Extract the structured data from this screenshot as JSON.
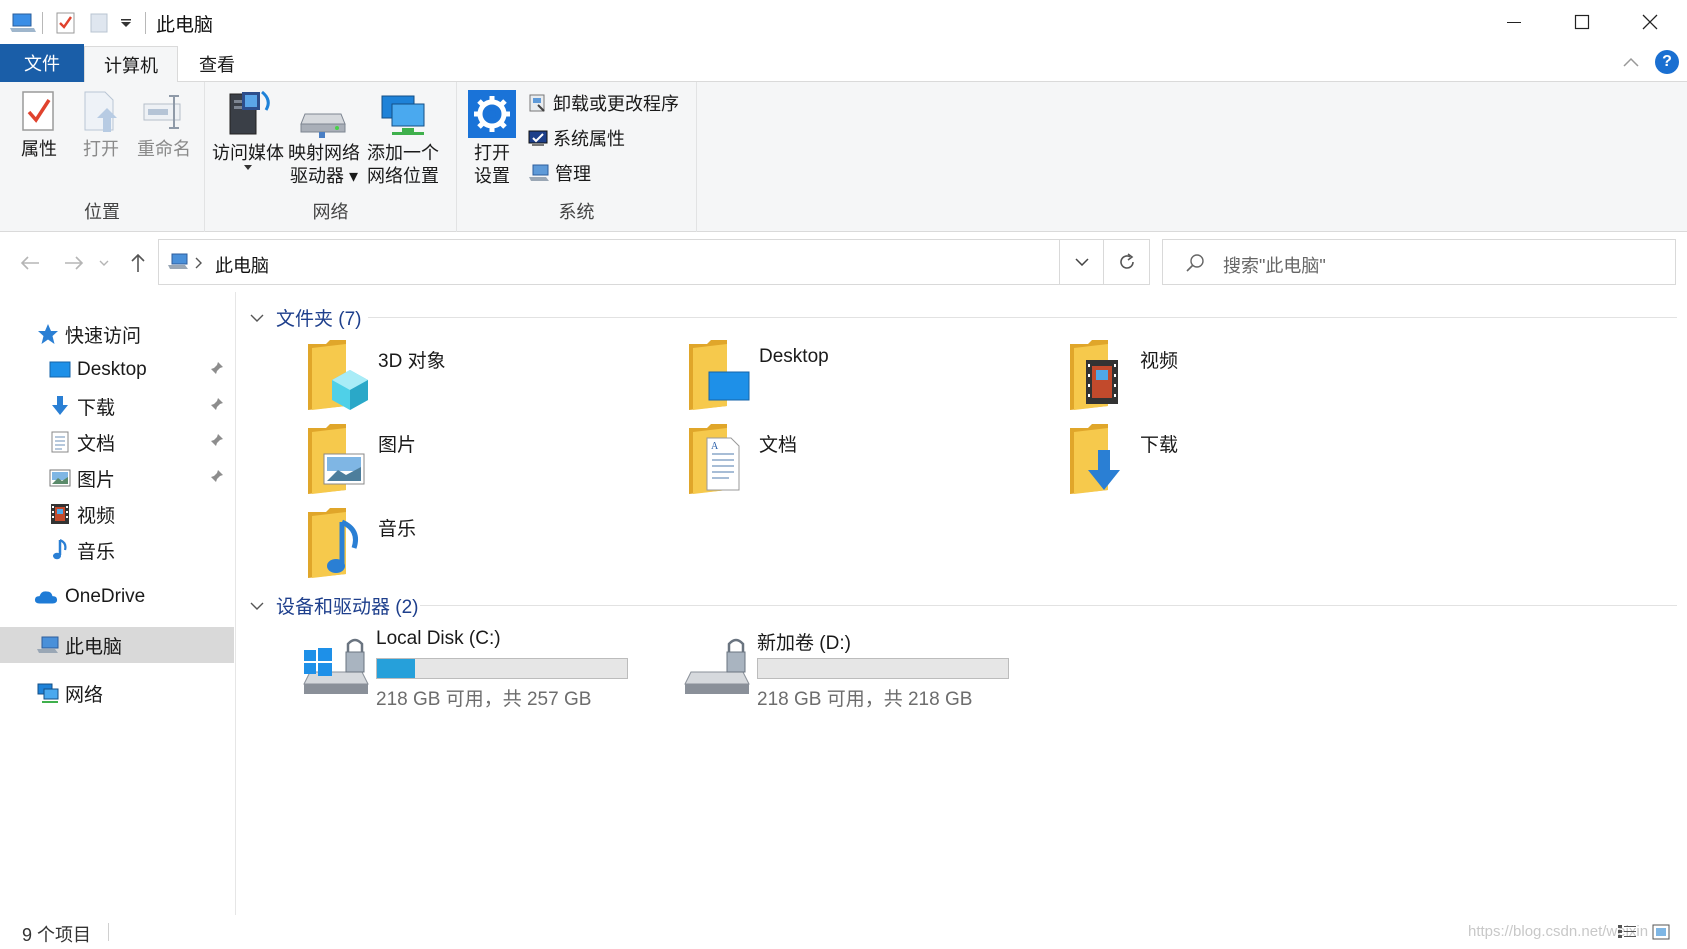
{
  "window": {
    "title": "此电脑"
  },
  "ribbon_tabs": {
    "file": "文件",
    "computer": "计算机",
    "view": "查看",
    "help": "?"
  },
  "ribbon": {
    "location_group": {
      "label": "位置",
      "properties": "属性",
      "open": "打开",
      "rename": "重命名"
    },
    "network_group": {
      "label": "网络",
      "access_media": "访问媒体",
      "map_drive_line1": "映射网络",
      "map_drive_line2": "驱动器",
      "add_location_line1": "添加一个",
      "add_location_line2": "网络位置"
    },
    "system_group": {
      "label": "系统",
      "open_settings_line1": "打开",
      "open_settings_line2": "设置",
      "uninstall": "卸载或更改程序",
      "system_properties": "系统属性",
      "manage": "管理"
    }
  },
  "address": {
    "path": "此电脑",
    "search_placeholder": "搜索\"此电脑\""
  },
  "sidebar": {
    "quick_access": "快速访问",
    "items": [
      {
        "label": "Desktop",
        "icon": "desktop-icon",
        "pinned": true
      },
      {
        "label": "下载",
        "icon": "download-icon",
        "pinned": true
      },
      {
        "label": "文档",
        "icon": "document-icon",
        "pinned": true
      },
      {
        "label": "图片",
        "icon": "picture-icon",
        "pinned": true
      },
      {
        "label": "视频",
        "icon": "video-icon",
        "pinned": false
      },
      {
        "label": "音乐",
        "icon": "music-icon",
        "pinned": false
      }
    ],
    "onedrive": "OneDrive",
    "this_pc": "此电脑",
    "network": "网络"
  },
  "content": {
    "folders_header": "文件夹 (7)",
    "folders": [
      {
        "name": "3D 对象",
        "icon": "3d-objects-folder-icon"
      },
      {
        "name": "Desktop",
        "icon": "desktop-folder-icon"
      },
      {
        "name": "视频",
        "icon": "videos-folder-icon"
      },
      {
        "name": "图片",
        "icon": "pictures-folder-icon"
      },
      {
        "name": "文档",
        "icon": "documents-folder-icon"
      },
      {
        "name": "下载",
        "icon": "downloads-folder-icon"
      },
      {
        "name": "音乐",
        "icon": "music-folder-icon"
      }
    ],
    "drives_header": "设备和驱动器 (2)",
    "drives": [
      {
        "name": "Local Disk (C:)",
        "info": "218 GB 可用，共 257 GB",
        "used_fraction": 0.152
      },
      {
        "name": "新加卷 (D:)",
        "info": "218 GB 可用，共 218 GB",
        "used_fraction": 0.0
      }
    ]
  },
  "status": {
    "item_count": "9 个项目",
    "watermark": "https://blog.csdn.net/weixin"
  },
  "colors": {
    "accent": "#1a5ea8",
    "section_header": "#1e3f8c",
    "drive_fill": "#26a0da",
    "folder_yellow": "#f6c94c"
  }
}
